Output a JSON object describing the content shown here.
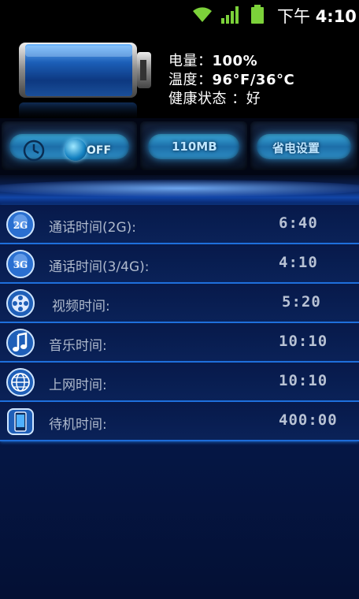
{
  "status_bar": {
    "time_prefix": "下午",
    "time": "4:10"
  },
  "battery_info": {
    "level_label": "电量：",
    "level_value": "100%",
    "temp_label": "温度：",
    "temp_value": "96°F/36°C",
    "health_label": "健康状态 ：",
    "health_value": "好"
  },
  "toolbar": {
    "toggle_state": "OFF",
    "memory": "110MB",
    "power_settings": "省电设置"
  },
  "usage_rows": [
    {
      "icon": "2g-icon",
      "label": "通话时间(2G):",
      "value": "6:40"
    },
    {
      "icon": "3g-icon",
      "label": "通话时间(3/4G):",
      "value": "4:10"
    },
    {
      "icon": "film-reel-icon",
      "label": "视频时间:",
      "value": "5:20"
    },
    {
      "icon": "music-note-icon",
      "label": "音乐时间:",
      "value": "10:10"
    },
    {
      "icon": "globe-icon",
      "label": "上网时间:",
      "value": "10:10"
    },
    {
      "icon": "phone-standby-icon",
      "label": "待机时间:",
      "value": "400:00"
    }
  ],
  "colors": {
    "accent_glow": "#3aa8d8",
    "row_divider": "#1e6cd8",
    "list_bg": "#061a4e",
    "signal_green": "#7cd13a"
  }
}
